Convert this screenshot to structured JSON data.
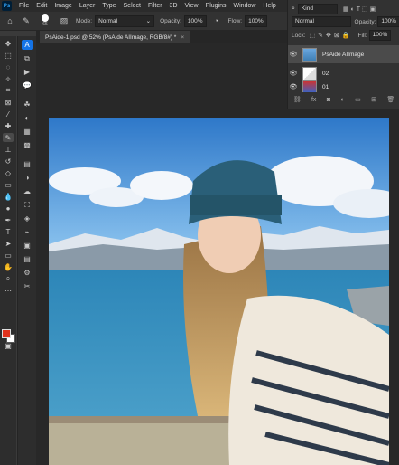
{
  "app": {
    "logo": "Ps"
  },
  "menu": [
    "File",
    "Edit",
    "Image",
    "Layer",
    "Type",
    "Select",
    "Filter",
    "3D",
    "View",
    "Plugins",
    "Window",
    "Help"
  ],
  "options_bar": {
    "brush_size": "65",
    "mode_label": "Mode:",
    "mode_value": "Normal",
    "opacity_label": "Opacity:",
    "opacity_value": "100%",
    "flow_label": "Flow:",
    "flow_value": "100%"
  },
  "document_tab": {
    "title": "PsAide-1.psd @ 52% (PsAide AIImage, RGB/8#) *",
    "close": "×"
  },
  "layers_panel": {
    "filter_kind": "Kind",
    "blend_mode": "Normal",
    "opacity_label": "Opacity:",
    "opacity_value": "100%",
    "lock_label": "Lock:",
    "fill_label": "Fill:",
    "fill_value": "100%",
    "layers": [
      {
        "name": "PsAide AIImage",
        "selected": true
      },
      {
        "name": "02",
        "selected": false
      },
      {
        "name": "01",
        "selected": false
      }
    ]
  },
  "colors": {
    "foreground": "#e0311c",
    "background": "#ffffff",
    "accent": "#31a8ff"
  }
}
